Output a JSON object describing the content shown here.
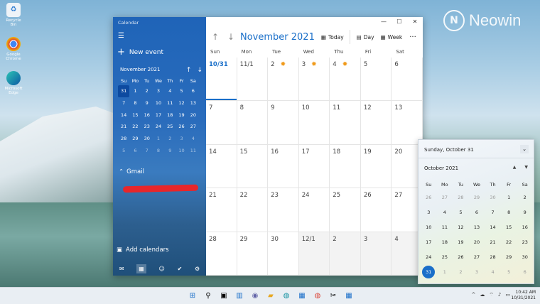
{
  "desktop": {
    "icons": [
      {
        "label": "Recycle Bin",
        "icon": "recycle-bin-icon"
      },
      {
        "label": "Google Chrome",
        "icon": "chrome-icon"
      },
      {
        "label": "Microsoft Edge",
        "icon": "edge-icon"
      }
    ],
    "watermark": "Neowin"
  },
  "window": {
    "app_title": "Calendar",
    "new_event": "New event",
    "mini_month": "November 2021",
    "mini_dow": [
      "Su",
      "Mo",
      "Tu",
      "We",
      "Th",
      "Fr",
      "Sa"
    ],
    "mini_days": [
      "31",
      "1",
      "2",
      "3",
      "4",
      "5",
      "6",
      "7",
      "8",
      "9",
      "10",
      "11",
      "12",
      "13",
      "14",
      "15",
      "16",
      "17",
      "18",
      "19",
      "20",
      "21",
      "22",
      "23",
      "24",
      "25",
      "26",
      "27",
      "28",
      "29",
      "30",
      "1",
      "2",
      "3",
      "4",
      "5",
      "6",
      "7",
      "8",
      "9",
      "10",
      "11"
    ],
    "account": "Gmail",
    "add_calendars": "Add calendars",
    "month_title": "November 2021",
    "today_label": "Today",
    "day_label": "Day",
    "week_label": "Week",
    "dow": [
      "Sun",
      "Mon",
      "Tue",
      "Wed",
      "Thu",
      "Fri",
      "Sat"
    ],
    "cells": [
      "10/31",
      "11/1",
      "2",
      "3",
      "4",
      "5",
      "6",
      "7",
      "8",
      "9",
      "10",
      "11",
      "12",
      "13",
      "14",
      "15",
      "16",
      "17",
      "18",
      "19",
      "20",
      "21",
      "22",
      "23",
      "24",
      "25",
      "26",
      "27",
      "28",
      "29",
      "30",
      "12/1",
      "2",
      "3",
      "4"
    ]
  },
  "flyout": {
    "date": "Sunday, October 31",
    "month": "October 2021",
    "dow": [
      "Su",
      "Mo",
      "Tu",
      "We",
      "Th",
      "Fr",
      "Sa"
    ],
    "days": [
      "26",
      "27",
      "28",
      "29",
      "30",
      "1",
      "2",
      "3",
      "4",
      "5",
      "6",
      "7",
      "8",
      "9",
      "10",
      "11",
      "12",
      "13",
      "14",
      "15",
      "16",
      "17",
      "18",
      "19",
      "20",
      "21",
      "22",
      "23",
      "24",
      "25",
      "26",
      "27",
      "28",
      "29",
      "30",
      "31",
      "1",
      "2",
      "3",
      "4",
      "5",
      "6"
    ]
  },
  "taskbar": {
    "time": "10:42 AM",
    "date": "10/31/2021"
  }
}
